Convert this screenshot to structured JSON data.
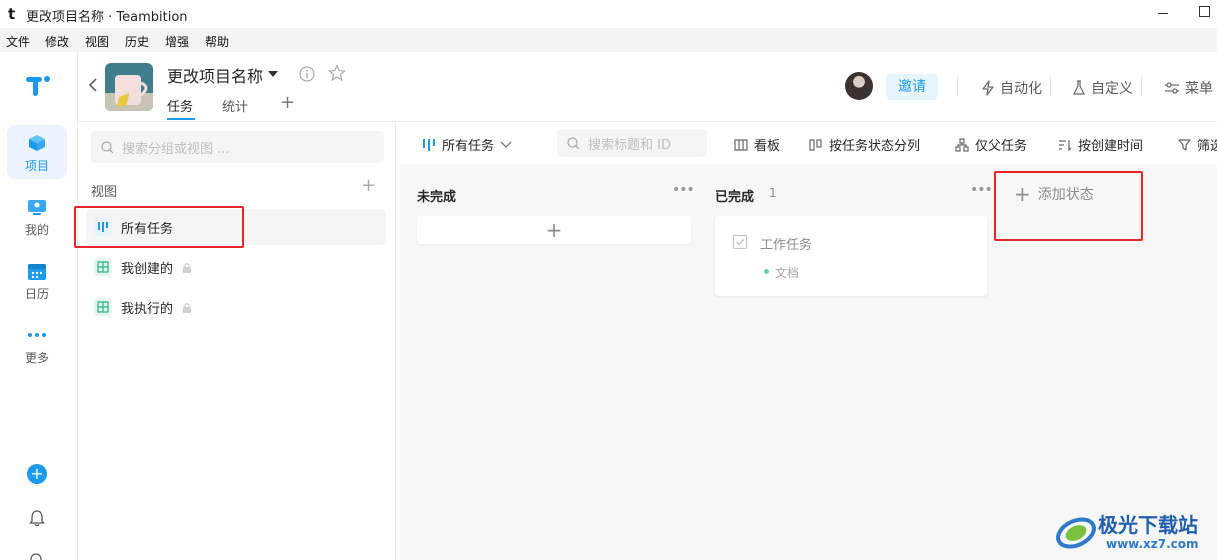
{
  "window": {
    "logo": "t",
    "title": "更改项目名称 · Teambition"
  },
  "menubar": [
    "文件",
    "修改",
    "视图",
    "历史",
    "增强",
    "帮助"
  ],
  "rail": {
    "items": [
      {
        "label": "项目",
        "icon": "cube-icon",
        "active": true
      },
      {
        "label": "我的",
        "icon": "person-monitor-icon"
      },
      {
        "label": "日历",
        "icon": "calendar-icon"
      },
      {
        "label": "更多",
        "icon": "more-dots-icon"
      }
    ]
  },
  "project": {
    "name": "更改项目名称",
    "tabs": [
      "任务",
      "统计"
    ],
    "invite_label": "邀请",
    "actions": [
      "自动化",
      "自定义",
      "菜单"
    ]
  },
  "views": {
    "search_placeholder": "搜索分组或视图 ...",
    "heading": "视图",
    "items": [
      {
        "label": "所有任务",
        "active": true
      },
      {
        "label": "我创建的",
        "locked": true
      },
      {
        "label": "我执行的",
        "locked": true
      }
    ]
  },
  "toolbar": {
    "view_select": "所有任务",
    "search_placeholder": "搜索标题和 ID",
    "kanban": "看板",
    "group_by": "按任务状态分列",
    "parent_only": "仅父任务",
    "sort": "按创建时间",
    "filter": "筛选"
  },
  "board": {
    "columns": [
      {
        "title": "未完成",
        "count": ""
      },
      {
        "title": "已完成",
        "count": "1"
      }
    ],
    "card": {
      "title": "工作任务",
      "tag": "文档"
    },
    "add_status": "添加状态"
  },
  "watermark": {
    "name": "极光下载站",
    "url": "www.xz7.com"
  },
  "colors": {
    "accent": "#1b9aee",
    "highlight_box": "#e8262a"
  }
}
